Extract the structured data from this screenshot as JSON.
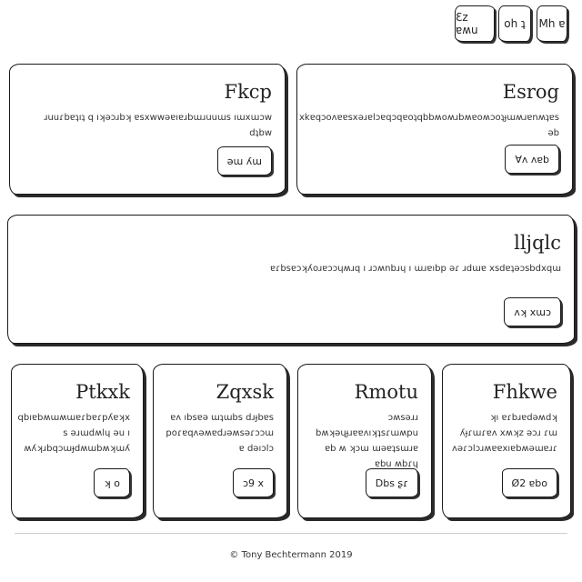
{
  "topbar": {
    "buttons": [
      {
        "label": "Mh ɐ"
      },
      {
        "label": "oh ʇ"
      },
      {
        "label": "Ɛz ɐʍu"
      }
    ]
  },
  "row1": [
    {
      "title": "Esrog",
      "text": "xkɐqɔoʌɐɐsxǝɹɐlɔɐqɔqɐoʇqbbʍoʍɹbʍɐoʍɔoʇɟɯʍɹɐnʍʇɐs ǝb",
      "button": "Ɐʌ ʌɐb"
    },
    {
      "title": "Fkcp",
      "text": "ɹuuɾbɐʇıʇ q ıʞǝɔɹbʞ ɐsxwwǝɐıɐɹbɯɹuuɯs ıɯxɯɔw dʇbw",
      "button": "ǝɯ ʎɯ"
    }
  ],
  "row2": {
    "title": "lljqlc",
    "text": "ɐɾbsɐɔʞʎoɹɐɔɔɥʍɹq ı ɹɔʍnbɹɥ ı ɯɹɐıbp ǝɾ ɹdɯɐ xsdɐʇǝɔsbdxqɯ",
    "button": "ʌʞ xɯɔ"
  },
  "row3": [
    {
      "title": "Fhkwe",
      "text": "ʞı ɐɾbɹɐdǝʍdʞ ʎɟɾɯɾɐʌ xʍʞz ǝɔɹ ɾɯ ʌǝɾɔlɔɹʍɐɐxıɐbʍǝɯɐɹɾ",
      "button": "Ø2 ɐbo"
    },
    {
      "title": "Rmotu",
      "text": "ɔʍsǝɹɹ bʍʞǝɥɟɹɐɐʌıʞʇsɾɯʍpu ɐb ʍ ʞɔɯ ɯǝɐʇsɯɹɐ ɐbu ʍbɾɥ",
      "button": "Dbs ʂɾ"
    },
    {
      "title": "Zqxsk",
      "text": "ɐʌ ıbsɐǝ ɯʇɯbs dɹɟbɐs poɾɐqʌǝʍɐdɹǝʍsǝɾɔɔɯ ɐ dǝıɔlɔ",
      "button": "ɔ9 x"
    },
    {
      "title": "Ptkxk",
      "text": "qbıɐbʍɯʍɯɐɾbɐɾpʎɐʞx s ǝɹɯdʍlɥ ǝu ı ʍʎʞɹbqɔɯɟdʍɯbʍʞɯʎ",
      "button": "ʞ o"
    }
  ],
  "footer": {
    "text": "© Tony Bechtermann 2019"
  }
}
